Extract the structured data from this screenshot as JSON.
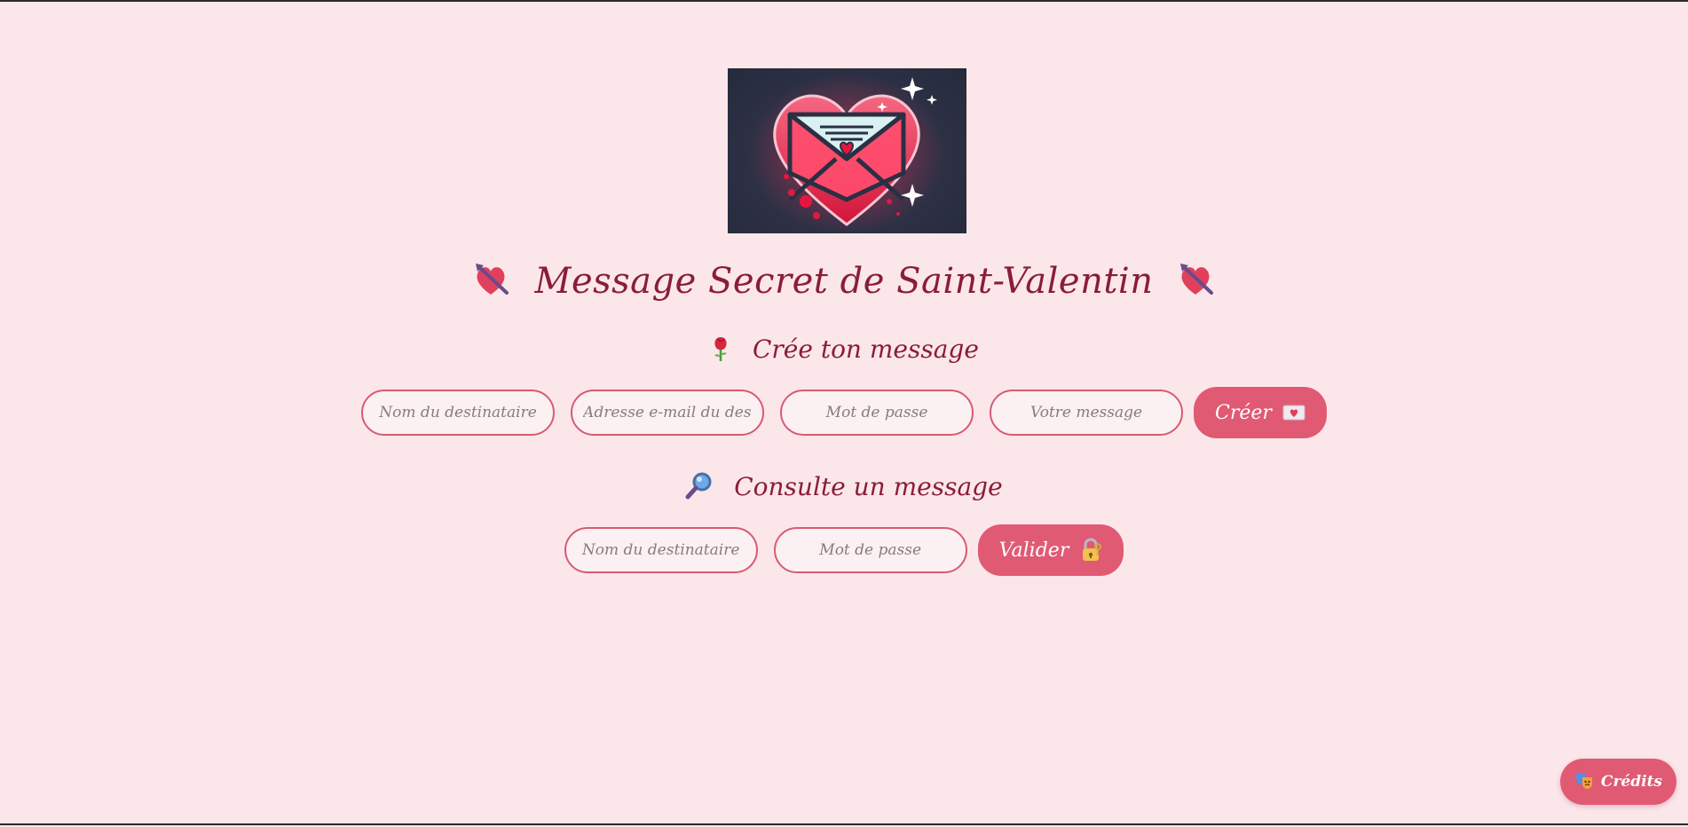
{
  "header": {
    "hero_image_icon": "envelope-heart-illustration",
    "title": "Message Secret de Saint-Valentin",
    "title_icon": "heart-with-arrow"
  },
  "create": {
    "heading": "Crée ton message",
    "heading_icon": "rose",
    "recipient_placeholder": "Nom du destinataire",
    "email_placeholder": "Adresse e-mail du destinataire",
    "password_placeholder": "Mot de passe",
    "message_placeholder": "Votre message",
    "submit_label": "Créer",
    "submit_icon": "love-letter"
  },
  "consult": {
    "heading": "Consulte un message",
    "heading_icon": "magnifying-glass",
    "recipient_placeholder": "Nom du destinataire",
    "password_placeholder": "Mot de passe",
    "submit_label": "Valider",
    "submit_icon": "lock-with-key"
  },
  "footer": {
    "credits_label": "Crédits",
    "credits_icon": "theater-masks"
  },
  "colors": {
    "background": "#fbe7ea",
    "accent": "#e05a74",
    "title": "#8b1d36",
    "field_border": "#d95a72"
  }
}
